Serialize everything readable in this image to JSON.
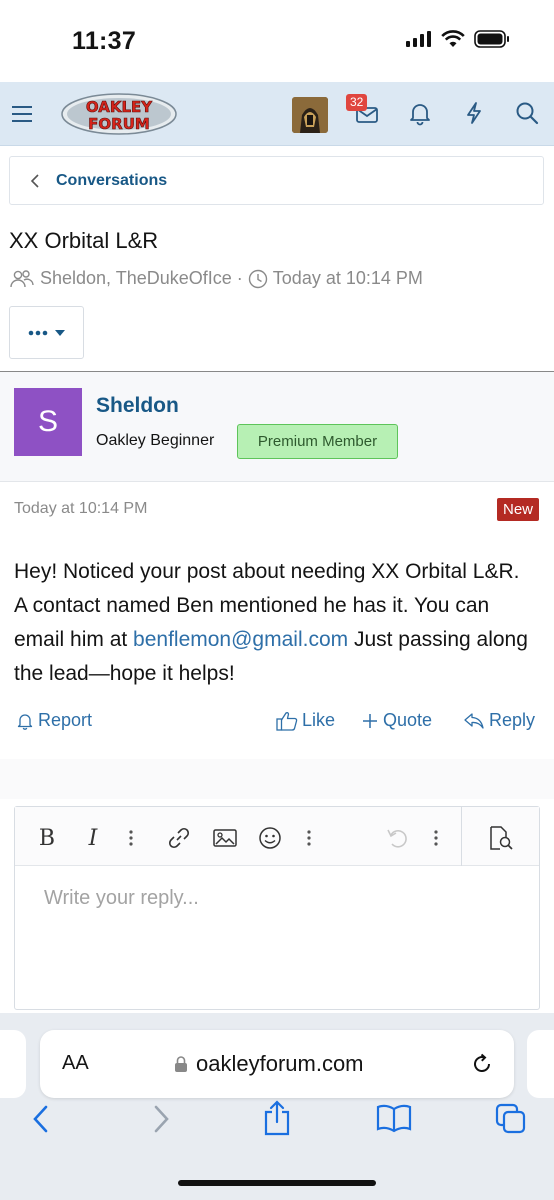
{
  "status_bar": {
    "time": "11:37"
  },
  "header": {
    "logo_line1": "OAKLEY",
    "logo_line2": "FORUM",
    "inbox_count": "32"
  },
  "breadcrumb": {
    "label": "Conversations"
  },
  "conversation": {
    "title": "XX Orbital L&R",
    "participants": "Sheldon, TheDukeOfIce",
    "separator": "·",
    "started": "Today at 10:14 PM"
  },
  "message": {
    "avatar_letter": "S",
    "username": "Sheldon",
    "user_title": "Oakley Beginner",
    "user_badge": "Premium Member",
    "date": "Today at 10:14 PM",
    "new_label": "New",
    "body_before": "Hey! Noticed your post about needing XX Orbital L&R. A contact named Ben mentioned he has it. You can email him at ",
    "email": "benflemon@gmail.com",
    "body_after": " Just passing along the lead—hope it helps!",
    "actions": {
      "report": "Report",
      "like": "Like",
      "quote": "Quote",
      "reply": "Reply"
    }
  },
  "editor": {
    "bold": "B",
    "italic": "I",
    "placeholder": "Write your reply..."
  },
  "browser": {
    "aa": "AA",
    "url": "oakleyforum.com"
  },
  "colors": {
    "link": "#185886",
    "header_bg": "#dce8f3",
    "badge_green": "#b7f0b4",
    "new_red": "#b42a23",
    "avatar_purple": "#8e51c4"
  }
}
